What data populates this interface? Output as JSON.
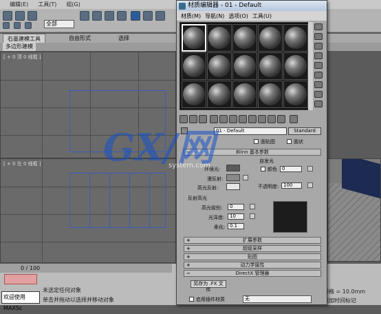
{
  "main": {
    "menus": [
      "编辑(E)",
      "工具(T)",
      "组(G)"
    ],
    "selection_filter": "全部",
    "ribbon_tabs": [
      "石墨建模工具",
      "自由形式",
      "选择"
    ],
    "active_subtab": "多边形建模",
    "viewport_top_label": "[ + 0 顶 0 线框 ]",
    "viewport_front_label": "[ + 0 左 0 线框 ]",
    "timeline": "0 / 100",
    "welcome": "欢迎使用 MAXSc",
    "status_line1": "未选定任何对象",
    "status_line2": "单击并拖动以选择并移动对象",
    "grid_readout": "栅格 = 10.0mm",
    "add_time_tag": "添加时间标记"
  },
  "material_editor": {
    "title": "材质编辑器 - 01 - Default",
    "menus": [
      "材质(M)",
      "导航(N)",
      "选项(O)",
      "工具(U)"
    ],
    "slot_count": 15,
    "active_slot": 0,
    "material_name": "01 - Default",
    "material_type": "Standard",
    "shader_options": [
      "面贴图",
      "面状"
    ],
    "basic_rollout": "Blinn 基本参数",
    "self_illum": "自发光",
    "ambient": "环境光:",
    "diffuse": "漫反射:",
    "specular": "高光反射:",
    "color": "颜色",
    "color_value": "0",
    "opacity_label": "不透明度:",
    "opacity_value": "100",
    "spec_highlights": "反射高光",
    "spec_level_label": "高光级别:",
    "spec_level": "0",
    "glossiness_label": "光泽度:",
    "glossiness": "10",
    "soften_label": "柔化:",
    "soften": "0.1",
    "rollouts": [
      "扩展参数",
      "超级采样",
      "贴图",
      "动力学属性",
      "DirectX 管理器"
    ],
    "save_fx": "另存为 .FX 文件",
    "enable_plugin": "启用插件材质",
    "plugin_value": "无"
  },
  "watermark": {
    "logo": "GX/网",
    "sub": "system.com"
  }
}
